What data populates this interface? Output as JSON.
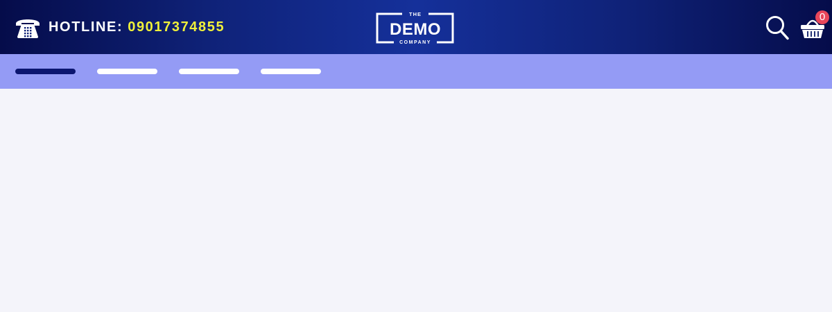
{
  "header": {
    "hotline_label": "HOTLINE:",
    "hotline_number": "09017374855",
    "hotline_icon": "telephone-icon",
    "logo": {
      "top_text": "THE",
      "main_text": "DEMO",
      "bottom_text": "COMPANY"
    },
    "search_icon": "search-icon",
    "cart_icon": "basket-icon",
    "cart_count": "0"
  },
  "nav": {
    "items": [
      {
        "icon": "nav-placeholder",
        "active": true
      },
      {
        "icon": "nav-placeholder",
        "active": false
      },
      {
        "icon": "nav-placeholder",
        "active": false
      },
      {
        "icon": "nav-placeholder",
        "active": false
      }
    ]
  },
  "colors": {
    "header_dark": "#050c4a",
    "header_mid": "#15309a",
    "hotline_number": "#f0f03a",
    "nav_bg": "#949bf5",
    "nav_active": "#0c1670",
    "cart_badge": "#e8465a",
    "page_bg": "#f4f4fa"
  }
}
